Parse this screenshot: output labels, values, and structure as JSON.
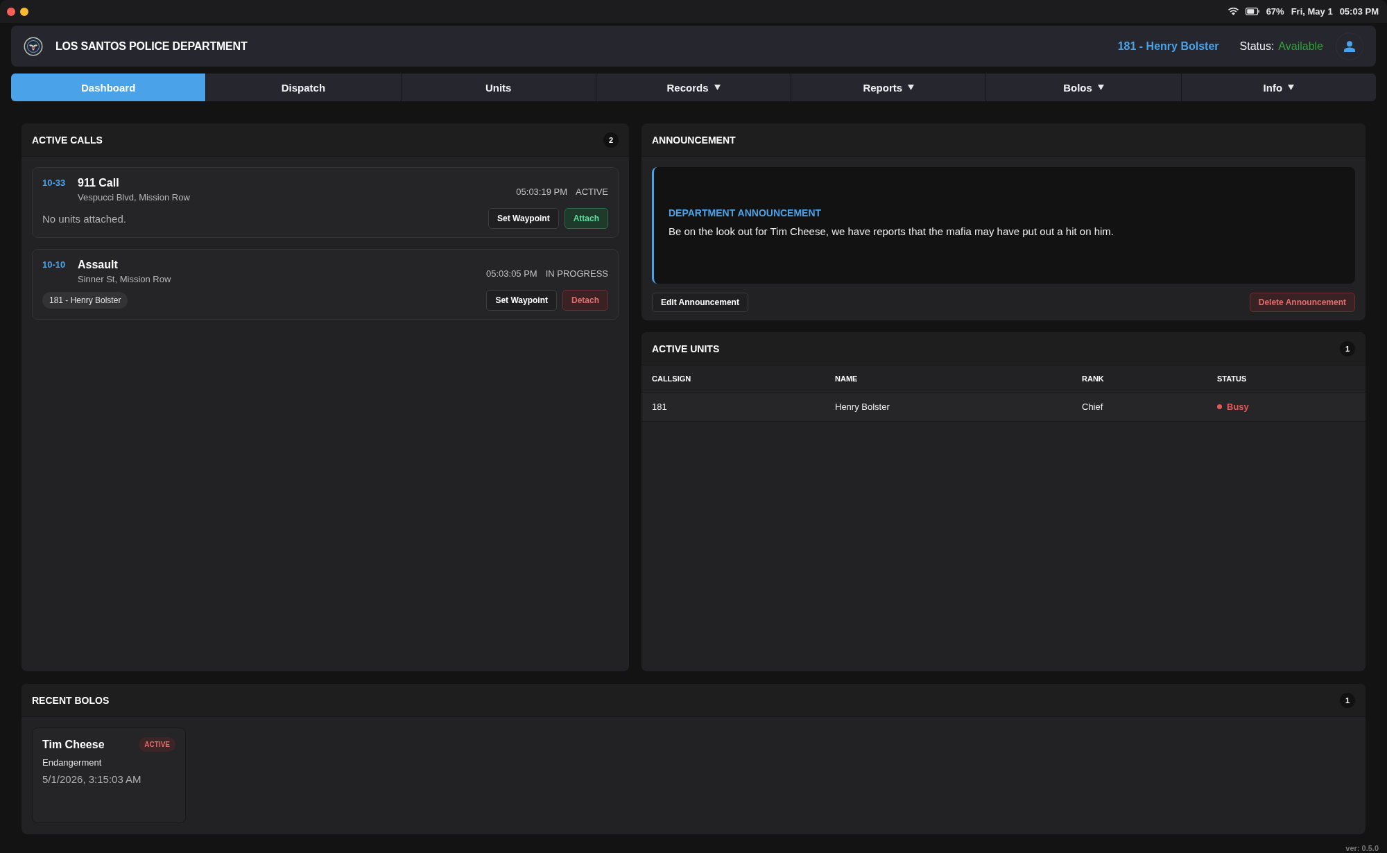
{
  "system_bar": {
    "battery": "67%",
    "date": "Fri, May 1",
    "time": "05:03 PM"
  },
  "header": {
    "title": "LOS SANTOS POLICE DEPARTMENT",
    "user": "181 - Henry Bolster",
    "status_label": "Status:",
    "status_value": "Available"
  },
  "tabs": [
    {
      "label": "Dashboard",
      "selected": true,
      "dropdown": false
    },
    {
      "label": "Dispatch",
      "selected": false,
      "dropdown": false
    },
    {
      "label": "Units",
      "selected": false,
      "dropdown": false
    },
    {
      "label": "Records",
      "selected": false,
      "dropdown": true
    },
    {
      "label": "Reports",
      "selected": false,
      "dropdown": true
    },
    {
      "label": "Bolos",
      "selected": false,
      "dropdown": true
    },
    {
      "label": "Info",
      "selected": false,
      "dropdown": true
    }
  ],
  "active_calls": {
    "title": "ACTIVE CALLS",
    "count": "2",
    "calls": [
      {
        "code": "10-33",
        "title": "911 Call",
        "location": "Vespucci Blvd, Mission Row",
        "time": "05:03:19 PM",
        "status": "ACTIVE",
        "note": "No units attached.",
        "actions": [
          {
            "label": "Set Waypoint",
            "kind": "neutral"
          },
          {
            "label": "Attach",
            "kind": "positive"
          }
        ]
      },
      {
        "code": "10-10",
        "title": "Assault",
        "location": "Sinner St, Mission Row",
        "time": "05:03:05 PM",
        "status": "IN PROGRESS",
        "units": [
          "181 - Henry Bolster"
        ],
        "actions": [
          {
            "label": "Set Waypoint",
            "kind": "neutral"
          },
          {
            "label": "Detach",
            "kind": "danger"
          }
        ]
      }
    ]
  },
  "announcement": {
    "title": "ANNOUNCEMENT",
    "heading": "DEPARTMENT ANNOUNCEMENT",
    "text": "Be on the look out for Tim Cheese, we have reports that the mafia may have put out a hit on him.",
    "buttons": [
      {
        "label": "Edit Announcement",
        "kind": "neutral"
      },
      {
        "label": "Delete Announcement",
        "kind": "danger"
      }
    ]
  },
  "active_units": {
    "title": "ACTIVE UNITS",
    "count": "1",
    "columns": [
      "CALLSIGN",
      "NAME",
      "RANK",
      "STATUS"
    ],
    "rows": [
      {
        "callsign": "181",
        "name": "Henry Bolster",
        "rank": "Chief",
        "status": "Busy",
        "color": "#e05a5a"
      }
    ]
  },
  "recent_bolos": {
    "title": "RECENT BOLOS",
    "count": "1",
    "bolos": [
      {
        "name": "Tim Cheese",
        "status": "ACTIVE",
        "reason": "Endangerment",
        "datetime": "5/1/2026, 3:15:03 AM"
      }
    ]
  },
  "version": "ver: 0.5.0"
}
